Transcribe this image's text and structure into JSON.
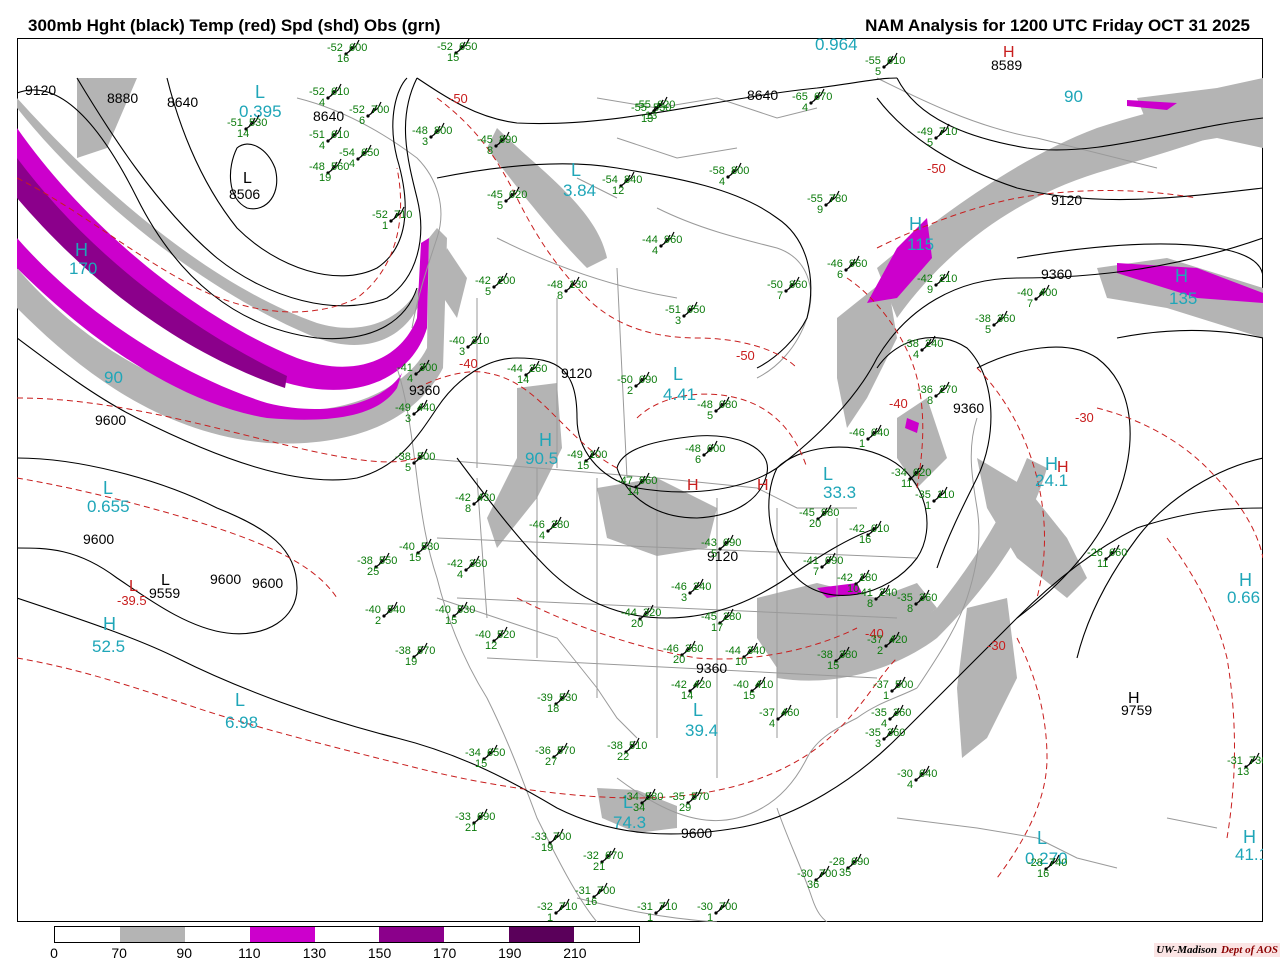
{
  "header": {
    "left_title": "300mb Hght (black) Temp (red) Spd (shd) Obs (grn)",
    "right_title": "NAM Analysis for 1200 UTC Friday  OCT 31 2025"
  },
  "colors": {
    "height_contour": "#000000",
    "temp_contour": "#c81e1e",
    "speed_70_90": "#b4b4b4",
    "speed_110_130": "#cc00cc",
    "speed_150_170": "#8b008b",
    "speed_190_210": "#5a005a",
    "centers": "#1fa6b8",
    "obs": "#0a7a0a",
    "borders": "#9a9a9a"
  },
  "colorbar": {
    "ticks": [
      "0",
      "70",
      "90",
      "110",
      "130",
      "150",
      "170",
      "190",
      "210"
    ],
    "segments": [
      "#ffffff",
      "#b4b4b4",
      "#ffffff",
      "#cc00cc",
      "#ffffff",
      "#8b008b",
      "#ffffff",
      "#5a005a",
      "#ffffff"
    ]
  },
  "credit": {
    "org": "UW-Madison",
    "dept": "Dept of AOS"
  },
  "height_labels": [
    "9120",
    "8880",
    "8640",
    "8640",
    "8506",
    "8640",
    "8589",
    "9120",
    "9360",
    "9600",
    "9600",
    "9600",
    "9600",
    "9559",
    "9360",
    "9120",
    "9120",
    "9360",
    "9360",
    "9600",
    "9759"
  ],
  "temp_labels": [
    "-50",
    "-50",
    "-40",
    "-50",
    "-40",
    "-30",
    "-30",
    "-40",
    "-39.5"
  ],
  "centers": [
    {
      "letter": "L",
      "value": "0.395"
    },
    {
      "letter": "H",
      "value": "170"
    },
    {
      "letter": "L",
      "value": "0.655"
    },
    {
      "letter": "H",
      "value": "52.5"
    },
    {
      "letter": "L",
      "value": "6.98"
    },
    {
      "letter": "H",
      "value": "90.5"
    },
    {
      "letter": "L",
      "value": "4.41"
    },
    {
      "letter": "L",
      "value": "3.84"
    },
    {
      "letter": "L",
      "value": "0.964"
    },
    {
      "letter": "H",
      "value": "115"
    },
    {
      "letter": "H",
      "value": "135"
    },
    {
      "letter": "L",
      "value": "39.4"
    },
    {
      "letter": "L",
      "value": "74.3"
    },
    {
      "letter": "L",
      "value": "0.270"
    },
    {
      "letter": "H",
      "value": "41.1"
    },
    {
      "letter": "H",
      "value": "0.66"
    },
    {
      "letter": "H",
      "value": "24.1"
    },
    {
      "letter": "L",
      "value": "33.3"
    }
  ],
  "speed_labels": [
    "90",
    "90"
  ],
  "obs": [
    [
      "-52",
      "600",
      "16"
    ],
    [
      "-52",
      "610",
      "4"
    ],
    [
      "-51",
      "530",
      "14"
    ],
    [
      "-48",
      "560",
      "19"
    ],
    [
      "-51",
      "610",
      "4"
    ],
    [
      "-54",
      "650",
      "4"
    ],
    [
      "-52",
      "700",
      "6"
    ],
    [
      "-48",
      "800",
      "3"
    ],
    [
      "-52",
      "710",
      "1"
    ],
    [
      "-52",
      "650",
      "15"
    ],
    [
      "-55",
      "530",
      "13"
    ],
    [
      "-55",
      "620",
      "13"
    ],
    [
      "-45",
      "890",
      "8"
    ],
    [
      "-45",
      "020",
      "5"
    ],
    [
      "-54",
      "840",
      "12"
    ],
    [
      "-58",
      "800",
      "4"
    ],
    [
      "-55",
      "780",
      "9"
    ],
    [
      "-55",
      "610",
      "5"
    ],
    [
      "-65",
      "670",
      "4"
    ],
    [
      "-49",
      "710",
      "5"
    ],
    [
      "-44",
      "960",
      "4"
    ],
    [
      "-46",
      "960",
      "6"
    ],
    [
      "-50",
      "860",
      "7"
    ],
    [
      "-42",
      "210",
      "9"
    ],
    [
      "-40",
      "400",
      "7"
    ],
    [
      "-38",
      "360",
      "5"
    ],
    [
      "-42",
      "200",
      "5"
    ],
    [
      "-48",
      "130",
      "8"
    ],
    [
      "-51",
      "050",
      "3"
    ],
    [
      "-42",
      "380",
      "4"
    ],
    [
      "-40",
      "310",
      "3"
    ],
    [
      "-44",
      "260",
      "14"
    ],
    [
      "-41",
      "300",
      "4"
    ],
    [
      "-49",
      "440",
      "3"
    ],
    [
      "-38",
      "240",
      "4"
    ],
    [
      "-36",
      "270",
      "8"
    ],
    [
      "-38",
      "500",
      "5"
    ],
    [
      "-42",
      "430",
      "8"
    ],
    [
      "-48",
      "000",
      "6"
    ],
    [
      "-48",
      "080",
      "5"
    ],
    [
      "-49",
      "100",
      "15"
    ],
    [
      "-50",
      "090",
      "2"
    ],
    [
      "-46",
      "040",
      "1"
    ],
    [
      "-34",
      "020",
      "11"
    ],
    [
      "-35",
      "110",
      "1"
    ],
    [
      "-47",
      "960",
      "14"
    ],
    [
      "-46",
      "280",
      "4"
    ],
    [
      "-40",
      "530",
      "15"
    ],
    [
      "-38",
      "550",
      "25"
    ],
    [
      "-40",
      "540",
      "2"
    ],
    [
      "-40",
      "530",
      "15"
    ],
    [
      "-40",
      "520",
      "12"
    ],
    [
      "-38",
      "570",
      "19"
    ],
    [
      "-43",
      "090",
      "5"
    ],
    [
      "-45",
      "980",
      "20"
    ],
    [
      "-42",
      "010",
      "16"
    ],
    [
      "-41",
      "090",
      "7"
    ],
    [
      "-46",
      "240",
      "3"
    ],
    [
      "-44",
      "320",
      "20"
    ],
    [
      "-45",
      "280",
      "17"
    ],
    [
      "-46",
      "360",
      "20"
    ],
    [
      "-44",
      "340",
      "10"
    ],
    [
      "-40",
      "410",
      "15"
    ],
    [
      "-42",
      "420",
      "14"
    ],
    [
      "-39",
      "530",
      "18"
    ],
    [
      "-37",
      "460",
      "4"
    ],
    [
      "-38",
      "380",
      "15"
    ],
    [
      "-37",
      "420",
      "2"
    ],
    [
      "-37",
      "500",
      "1"
    ],
    [
      "-35",
      "360",
      "4"
    ],
    [
      "-35",
      "360",
      "3"
    ],
    [
      "-34",
      "650",
      "15"
    ],
    [
      "-36",
      "570",
      "27"
    ],
    [
      "-38",
      "510",
      "22"
    ],
    [
      "-34",
      "580",
      "34"
    ],
    [
      "-35",
      "570",
      "29"
    ],
    [
      "-30",
      "640",
      "4"
    ],
    [
      "-33",
      "690",
      "21"
    ],
    [
      "-33",
      "700",
      "19"
    ],
    [
      "-32",
      "670",
      "21"
    ],
    [
      "-31",
      "700",
      "16"
    ],
    [
      "-32",
      "710",
      "1"
    ],
    [
      "-31",
      "710",
      "1"
    ],
    [
      "-30",
      "700",
      "1"
    ],
    [
      "-30",
      "700",
      "36"
    ],
    [
      "-28",
      "690",
      "35"
    ],
    [
      "-28",
      "740",
      "16"
    ],
    [
      "-31",
      "730",
      "13"
    ],
    [
      "-26",
      "660",
      "11"
    ],
    [
      "-42",
      "180",
      "10"
    ],
    [
      "-41",
      "240",
      "8"
    ],
    [
      "-35",
      "360",
      "8"
    ]
  ]
}
